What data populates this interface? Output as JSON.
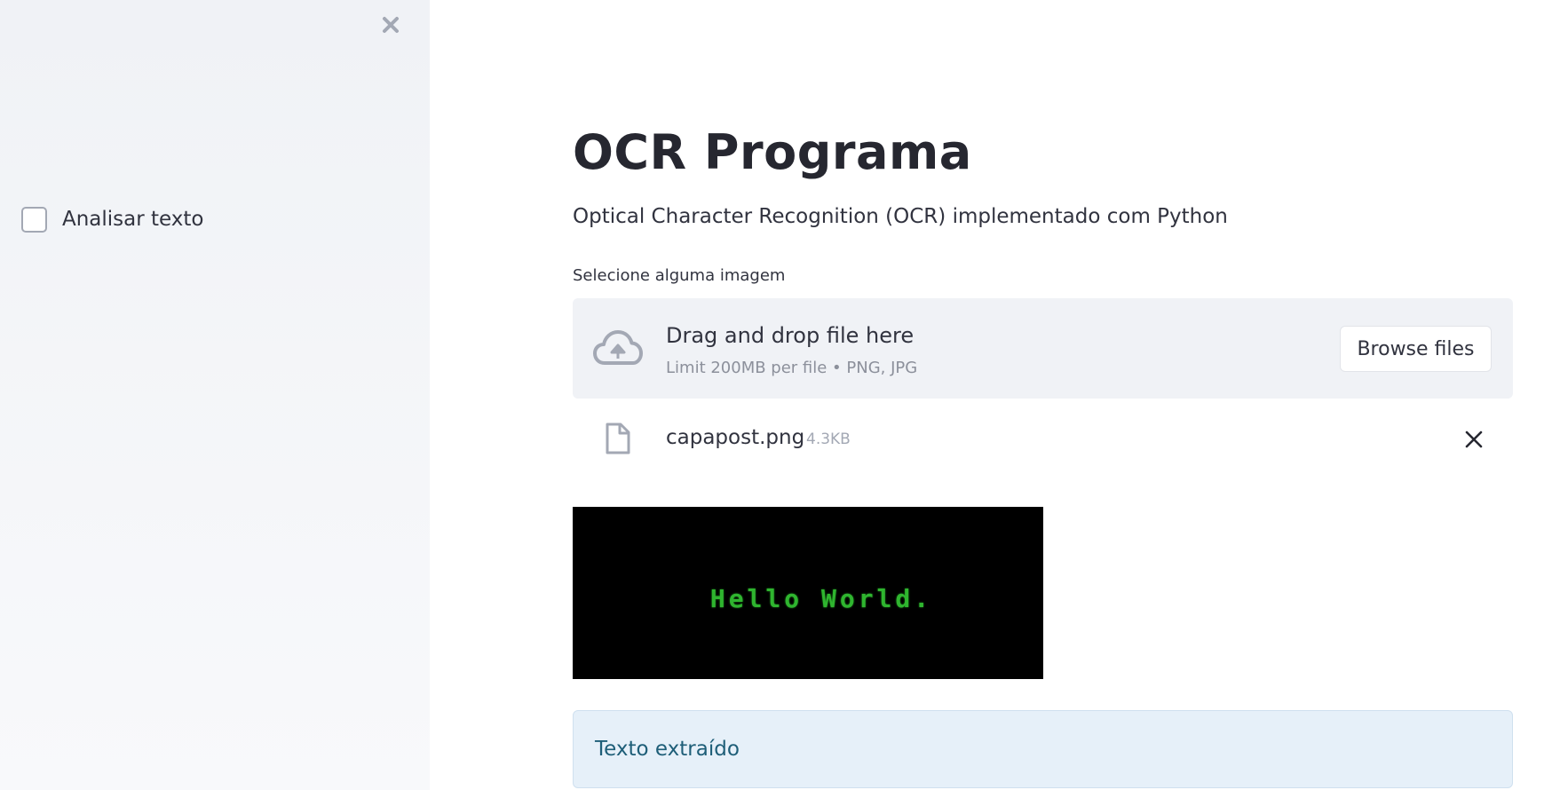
{
  "sidebar": {
    "close_icon": "close-icon",
    "checkbox": {
      "label": "Analisar texto",
      "checked": false
    }
  },
  "main": {
    "title": "OCR Programa",
    "subtitle": "Optical Character Recognition (OCR) implementado com Python",
    "uploader": {
      "label": "Selecione alguma imagem",
      "dropzone_title": "Drag and drop file here",
      "dropzone_limit": "Limit 200MB per file • PNG, JPG",
      "browse_label": "Browse files",
      "icon": "cloud-upload-icon"
    },
    "uploaded_file": {
      "name": "capapost.png",
      "size": "4.3KB",
      "icon": "file-icon",
      "delete_icon": "close-icon"
    },
    "preview": {
      "text": "Hello World."
    },
    "info": {
      "text": "Texto extraído"
    }
  },
  "colors": {
    "sidebar_bg": "#f0f2f6",
    "text": "#262730",
    "info_bg": "#e6f0f9",
    "info_text": "#1e5e78",
    "preview_text": "#2fb52f"
  }
}
